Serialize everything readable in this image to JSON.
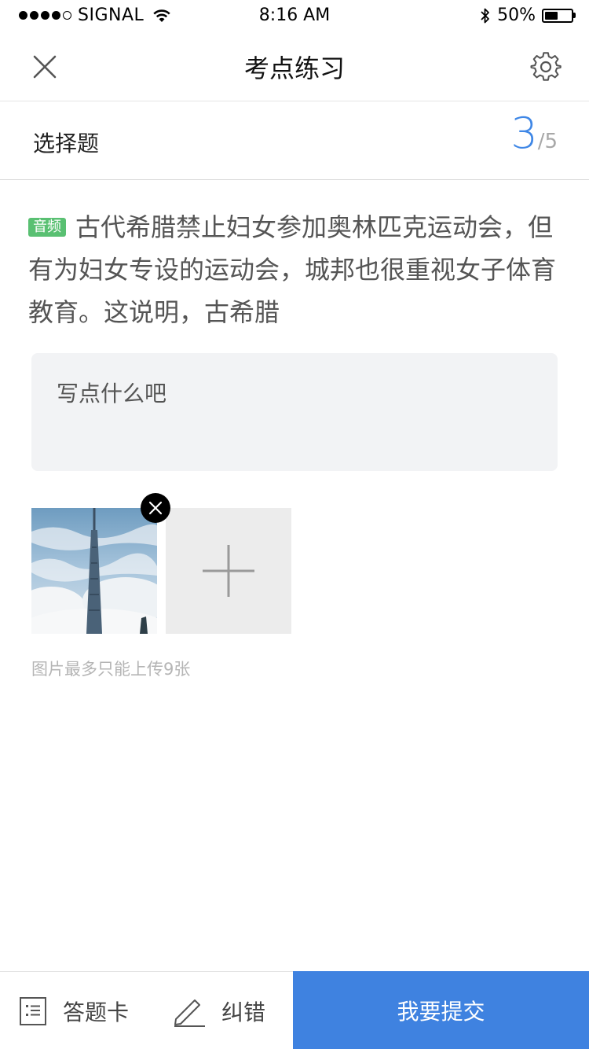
{
  "status_bar": {
    "signal_dots": 5,
    "signal_filled": 4,
    "carrier": "SIGNAL",
    "time": "8:16 AM",
    "battery_text": "50%",
    "battery_level": 0.5
  },
  "nav": {
    "title": "考点练习",
    "close_icon": "close-icon",
    "settings_icon": "gear-icon"
  },
  "question_header": {
    "type_label": "选择题",
    "current": "3",
    "total": "/5"
  },
  "question": {
    "tag": "音频",
    "text": "古代希腊禁止妇女参加奥林匹克运动会，但有为妇女专设的运动会，城邦也很重视女子体育教育。这说明，古希腊"
  },
  "answer": {
    "placeholder": "写点什么吧",
    "value": ""
  },
  "images": {
    "hint": "图片最多只能上传9张",
    "count": 1
  },
  "bottom_bar": {
    "answer_card_label": "答题卡",
    "correction_label": "纠错",
    "submit_label": "我要提交"
  },
  "colors": {
    "accent": "#3f82e0",
    "progress": "#3f87e6",
    "tag": "#59c072"
  }
}
